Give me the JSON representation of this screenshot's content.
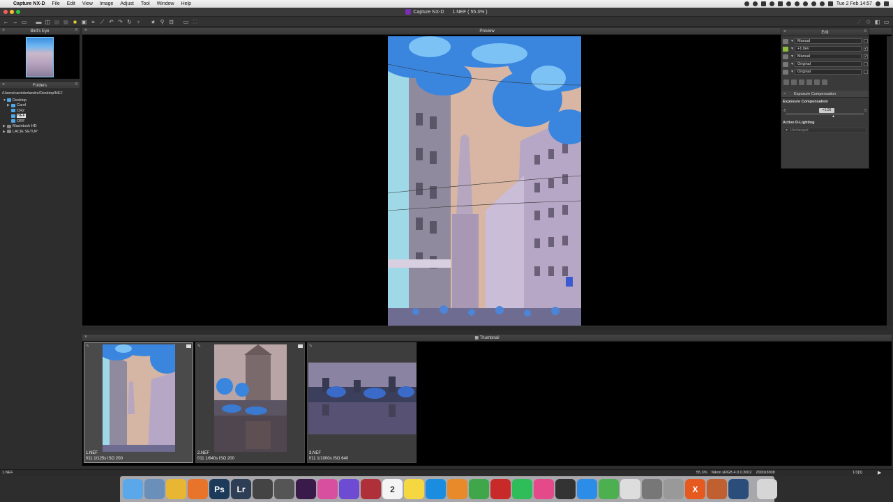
{
  "menubar": {
    "app_name": "Capture NX-D",
    "items": [
      "File",
      "Edit",
      "View",
      "Image",
      "Adjust",
      "Tool",
      "Window",
      "Help"
    ],
    "clock": "Tue 2 Feb  14:57"
  },
  "window": {
    "title": "Capture NX-D",
    "document": "1.NEF ( 55.3% )"
  },
  "panels": {
    "birds_eye": "Bird's Eye",
    "folders": "Folders",
    "preview": "Preview",
    "edit": "Edit",
    "thumbnail": "Thumbnail"
  },
  "folders": {
    "path": "/Users/carolderlandre/Desktop/NEF",
    "tree": [
      {
        "label": "Desktop",
        "depth": 0,
        "expanded": true,
        "type": "folder"
      },
      {
        "label": "Carol",
        "depth": 1,
        "expanded": false,
        "type": "folder"
      },
      {
        "label": "CR2",
        "depth": 1,
        "expanded": false,
        "type": "folder"
      },
      {
        "label": "NEF",
        "depth": 1,
        "expanded": false,
        "type": "folder",
        "selected": true
      },
      {
        "label": "ORF",
        "depth": 1,
        "expanded": false,
        "type": "folder"
      },
      {
        "label": "Macintosh HD",
        "depth": 0,
        "expanded": false,
        "type": "drive"
      },
      {
        "label": "LACIE SETUP",
        "depth": 0,
        "expanded": false,
        "type": "drive"
      }
    ]
  },
  "edit_panel": {
    "rows": [
      {
        "value": "Manual",
        "checked": false
      },
      {
        "value": "+1.0ev",
        "checked": true
      },
      {
        "value": "Manual",
        "checked": true
      },
      {
        "value": "Original",
        "checked": false
      },
      {
        "value": "Original",
        "checked": false
      }
    ],
    "section_title": "Exposure Compensation",
    "exposure_label": "Exposure Compensation",
    "slider_min": "-5",
    "slider_max": "5",
    "slider_value": "+1.00",
    "adl_label": "Active D-Lighting",
    "adl_value": "Unchanged"
  },
  "thumbnails": [
    {
      "name": "1.NEF",
      "info": "f/11 1/125s ISO 200",
      "selected": true
    },
    {
      "name": "2.NEF",
      "info": "f/11 1/640s ISO 200",
      "selected": false
    },
    {
      "name": "3.NEF",
      "info": "f/11 1/1000s ISO 640",
      "selected": false
    }
  ],
  "status": {
    "left": "1.NEF",
    "zoom": "55.3%",
    "profile": "Nikon sRGB 4.0.0.3002",
    "dimensions": "2000x3008",
    "page": "1/3[3]"
  },
  "dock": [
    {
      "name": "finder-icon",
      "color": "#5aa8ea"
    },
    {
      "name": "preview-app-icon",
      "color": "#6a8fb8"
    },
    {
      "name": "chrome-icon",
      "color": "#e9b634"
    },
    {
      "name": "firefox-icon",
      "color": "#e8742b"
    },
    {
      "name": "photoshop-icon",
      "color": "#1c3a5a",
      "text": "Ps"
    },
    {
      "name": "lightroom-icon",
      "color": "#2e3e55",
      "text": "Lr"
    },
    {
      "name": "photo-browser-icon",
      "color": "#444"
    },
    {
      "name": "capture-one-icon",
      "color": "#555"
    },
    {
      "name": "capture-nxd-icon",
      "color": "#3a1a4a"
    },
    {
      "name": "color-wheel-icon",
      "color": "#d84fa0"
    },
    {
      "name": "imovie-star-icon",
      "color": "#6d4bd3"
    },
    {
      "name": "photo-booth-icon",
      "color": "#b0303a"
    },
    {
      "name": "calendar-icon",
      "color": "#f4f4f4",
      "text": "2"
    },
    {
      "name": "notes-icon",
      "color": "#f5d742"
    },
    {
      "name": "teamviewer-icon",
      "color": "#1a8de0"
    },
    {
      "name": "pages-icon",
      "color": "#e98a2a"
    },
    {
      "name": "numbers-icon",
      "color": "#3fa74a"
    },
    {
      "name": "filezilla-icon",
      "color": "#c82a2a"
    },
    {
      "name": "spotify-icon",
      "color": "#2ebd59"
    },
    {
      "name": "itunes-icon",
      "color": "#e44a8a"
    },
    {
      "name": "sketch-icon",
      "color": "#333"
    },
    {
      "name": "app-store-icon",
      "color": "#2b8de8"
    },
    {
      "name": "maps-icon",
      "color": "#4caf50"
    },
    {
      "name": "textedit-icon",
      "color": "#ddd"
    },
    {
      "name": "system-preferences-icon",
      "color": "#777"
    },
    {
      "name": "automator-icon",
      "color": "#999"
    },
    {
      "name": "crossover-icon",
      "color": "#e65a1f",
      "text": "X"
    },
    {
      "name": "archive-icon",
      "color": "#c06030"
    },
    {
      "name": "quicktime-icon",
      "color": "#2a4d7a"
    },
    {
      "name": "trash-icon",
      "color": "#d6d6d6"
    }
  ]
}
